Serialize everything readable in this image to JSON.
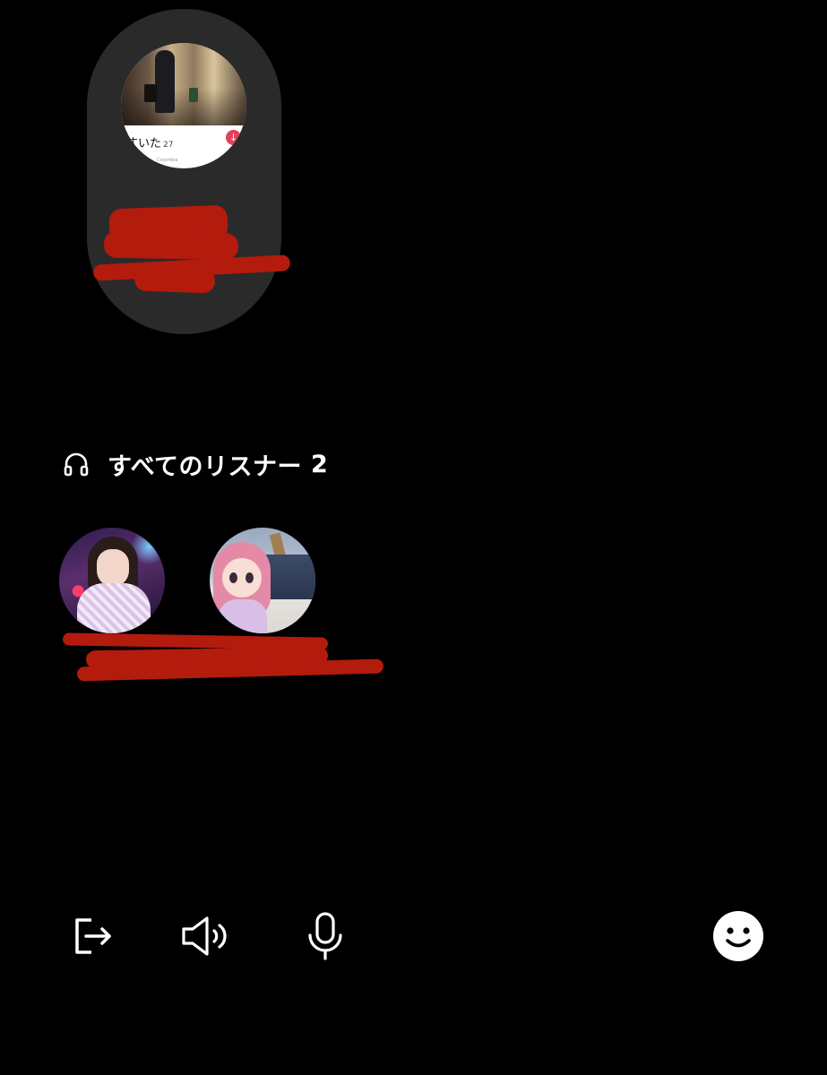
{
  "host": {
    "caption_text": "すいた",
    "caption_count": "27",
    "caption_sub": "Colombia",
    "badge_icon": "download-arrow-icon"
  },
  "listeners": {
    "title": "すべてのリスナー",
    "count": "2",
    "icon": "headphones-icon"
  },
  "toolbar": {
    "leave_icon": "leave-icon",
    "speaker_icon": "speaker-icon",
    "mic_icon": "microphone-icon",
    "reaction_icon": "emoji-smile-icon"
  },
  "colors": {
    "background": "#000000",
    "card": "#2a2a2a",
    "redaction": "#b31b0d",
    "text": "#ffffff"
  }
}
